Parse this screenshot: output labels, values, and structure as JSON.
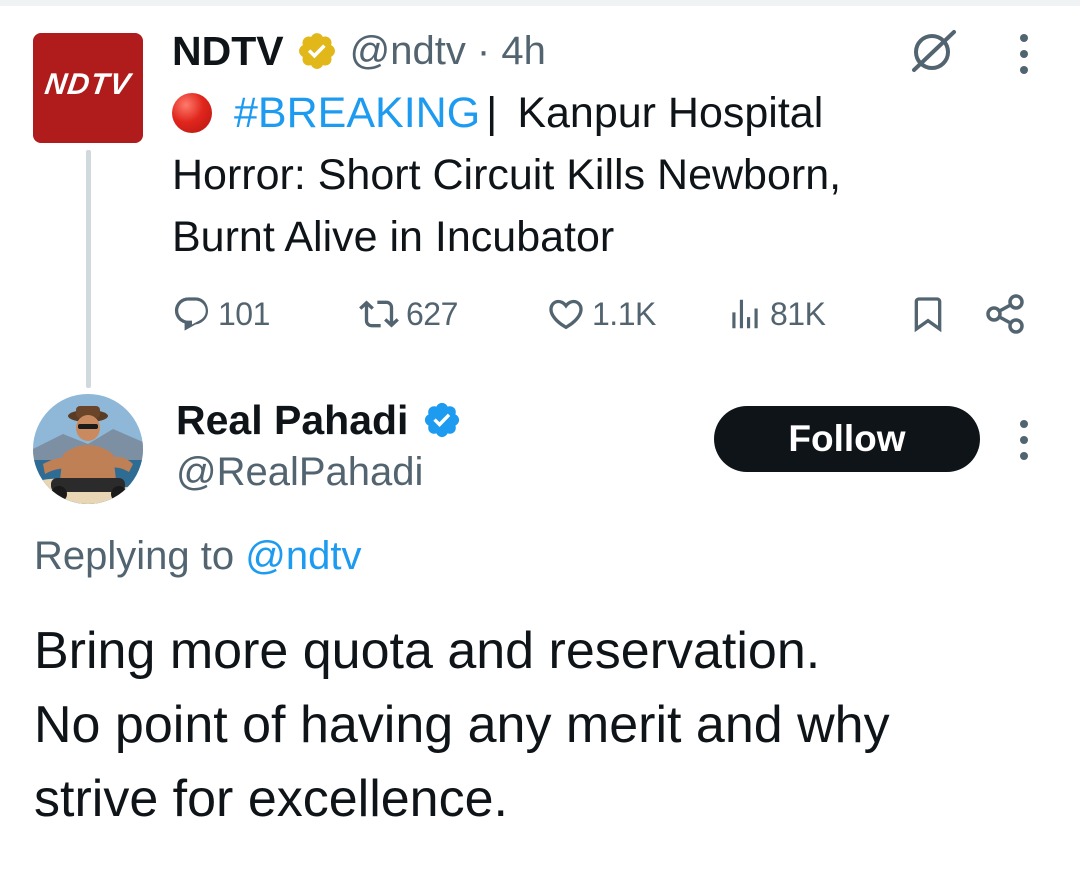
{
  "parent_tweet": {
    "name": "NDTV",
    "avatar_text": "NDTV",
    "handle_time": "@ndtv · 4h",
    "body_lines": {
      "hashtag": "#BREAKING",
      "separator": "|",
      "line1_rest": "Kanpur Hospital",
      "line2": "Horror: Short Circuit Kills Newborn,",
      "line3": "Burnt Alive in Incubator"
    },
    "actions": {
      "replies": "101",
      "reposts": "627",
      "likes": "1.1K",
      "views": "81K"
    },
    "icons": [
      "verified-gold-icon",
      "grok-icon",
      "more-icon",
      "red-circle-emoji",
      "reply-icon",
      "repost-icon",
      "like-icon",
      "views-icon",
      "bookmark-icon",
      "share-icon"
    ]
  },
  "reply_tweet": {
    "name": "Real Pahadi",
    "handle": "@RealPahadi",
    "follow_label": "Follow",
    "replying_prefix": "Replying to",
    "replying_mention": "@ndtv",
    "text_lines": {
      "line1": "Bring more quota and reservation.",
      "line2": "No point of having any merit and why",
      "line3": "strive for excellence."
    },
    "icons": [
      "verified-blue-icon",
      "more-icon"
    ]
  },
  "colors": {
    "accent_blue": "#1d9bf0",
    "text_primary": "#0f1419",
    "text_secondary": "#536471",
    "ndtv_red": "#b01b1b",
    "verified_gold": "#e2b719"
  }
}
